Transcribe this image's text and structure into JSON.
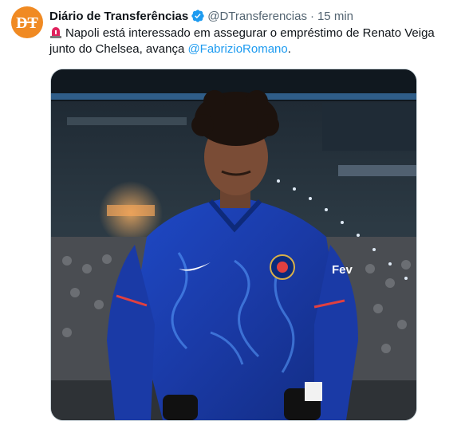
{
  "tweet": {
    "display_name": "Diário de Transferências",
    "handle": "@DTransferencias",
    "separator": "·",
    "time": "15 min",
    "text_main": "Napoli está interessado em assegurar o empréstimo de Renato Veiga junto do Chelsea, avança ",
    "mention": "@FabrizioRomano",
    "text_end": ".",
    "avatar_text": "DT",
    "emoji": "police-light-siren-icon"
  },
  "media": {
    "shirt_sponsor": "Fev",
    "icon": "football-player-photo"
  },
  "colors": {
    "avatar_bg": "#f08a23",
    "verified": "#1d9bf0",
    "link": "#1d9bf0",
    "shirt": "#1a3aa6"
  }
}
